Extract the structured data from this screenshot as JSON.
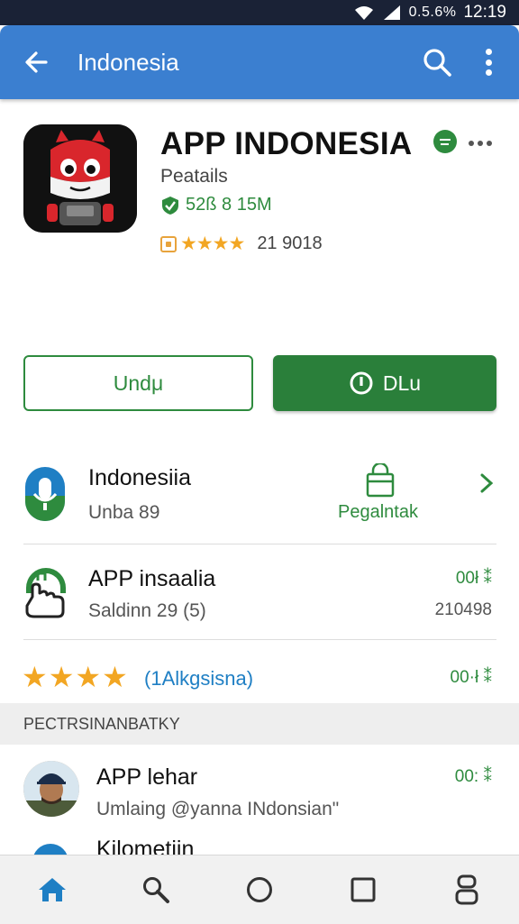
{
  "status_bar": {
    "battery": "0.5.6%",
    "time": "12:19"
  },
  "app_bar": {
    "title": "Indonesia"
  },
  "app": {
    "name": "APP INDONESIA",
    "subtitle": "Peatails",
    "size_text": "52ß 8 15M",
    "rating_text": "21 9018",
    "stars": 4
  },
  "buttons": {
    "secondary_label": "Undμ",
    "primary_label": "DLu"
  },
  "rows": [
    {
      "title": "Indonesiia",
      "subtitle": "Unba 89",
      "action_label": "Pegalntak"
    },
    {
      "title": "APP insaalia",
      "subtitle": "Saldinn 29 (5)",
      "right_top": "00ł ⁑",
      "right_bottom": "210498"
    },
    {
      "rating_text": "1Alkgsisna)",
      "right": "00·ł ⁑",
      "stars": 4
    }
  ],
  "section": {
    "header": "PECTRSINANBATKY"
  },
  "review": {
    "title": "APP lehar",
    "text": "Umlaing @yanna INdonsian\"",
    "right": "00: ⁑",
    "next_title": "Kilometiin"
  },
  "colors": {
    "app_bar": "#3b7fd0",
    "accent_green": "#2a7f3a",
    "star": "#f2a623"
  }
}
